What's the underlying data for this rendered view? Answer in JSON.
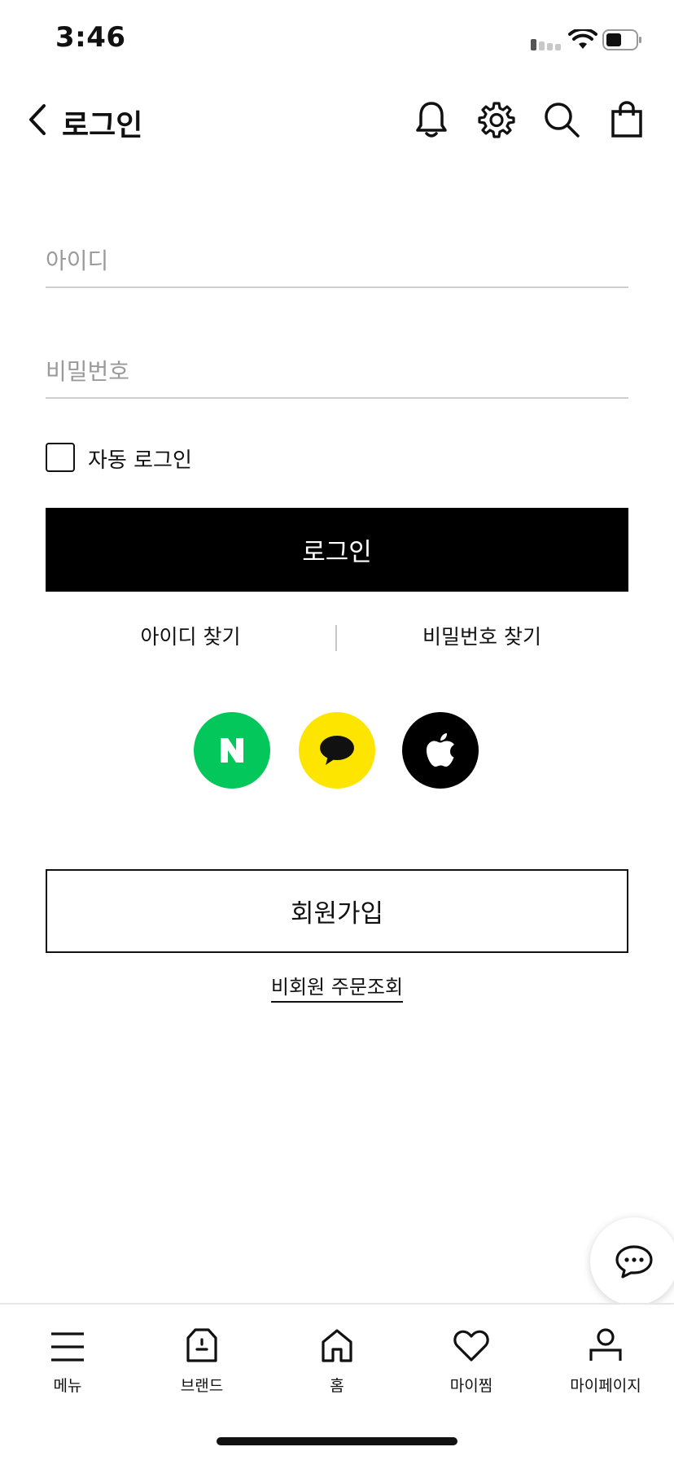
{
  "status_bar": {
    "time": "3:46"
  },
  "header": {
    "title": "로그인"
  },
  "form": {
    "id_placeholder": "아이디",
    "id_value": "",
    "password_placeholder": "비밀번호",
    "password_value": "",
    "auto_login_label": "자동 로그인",
    "auto_login_checked": false,
    "login_button": "로그인",
    "find_id": "아이디 찾기",
    "find_password": "비밀번호 찾기"
  },
  "social": [
    {
      "name": "naver",
      "color": "#03C75A",
      "glyph": "N"
    },
    {
      "name": "kakao",
      "color": "#FEE500"
    },
    {
      "name": "apple",
      "color": "#000000"
    }
  ],
  "signup_button": "회원가입",
  "guest_order": "비회원 주문조회",
  "tabs": [
    {
      "label": "메뉴",
      "icon": "menu-icon"
    },
    {
      "label": "브랜드",
      "icon": "tag-icon"
    },
    {
      "label": "홈",
      "icon": "home-icon"
    },
    {
      "label": "마이찜",
      "icon": "heart-icon"
    },
    {
      "label": "마이페이지",
      "icon": "person-icon"
    }
  ]
}
